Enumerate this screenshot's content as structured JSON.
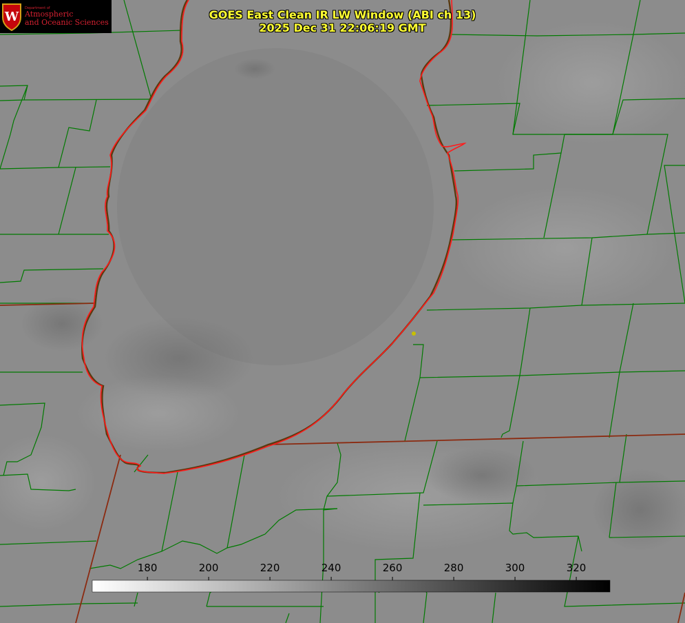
{
  "title": {
    "line1": "GOES East Clean IR LW Window (ABI ch 13)",
    "line2": "2025 Dec 31 22:06:19 GMT"
  },
  "logo": {
    "dept": "Department of",
    "line1": "Atmospheric",
    "line2": "and Oceanic Sciences",
    "crest_letter": "W",
    "icon": "uw-crest-icon"
  },
  "colorbar": {
    "min": 162,
    "max": 331,
    "ticks": [
      180,
      200,
      220,
      240,
      260,
      280,
      300,
      320
    ],
    "gradient": "white-to-black"
  },
  "colors": {
    "title": "#ffff33",
    "coast": "#ff1a1a",
    "county": "#007a00",
    "state": "#8b2a10",
    "marker": "#c8c000"
  }
}
